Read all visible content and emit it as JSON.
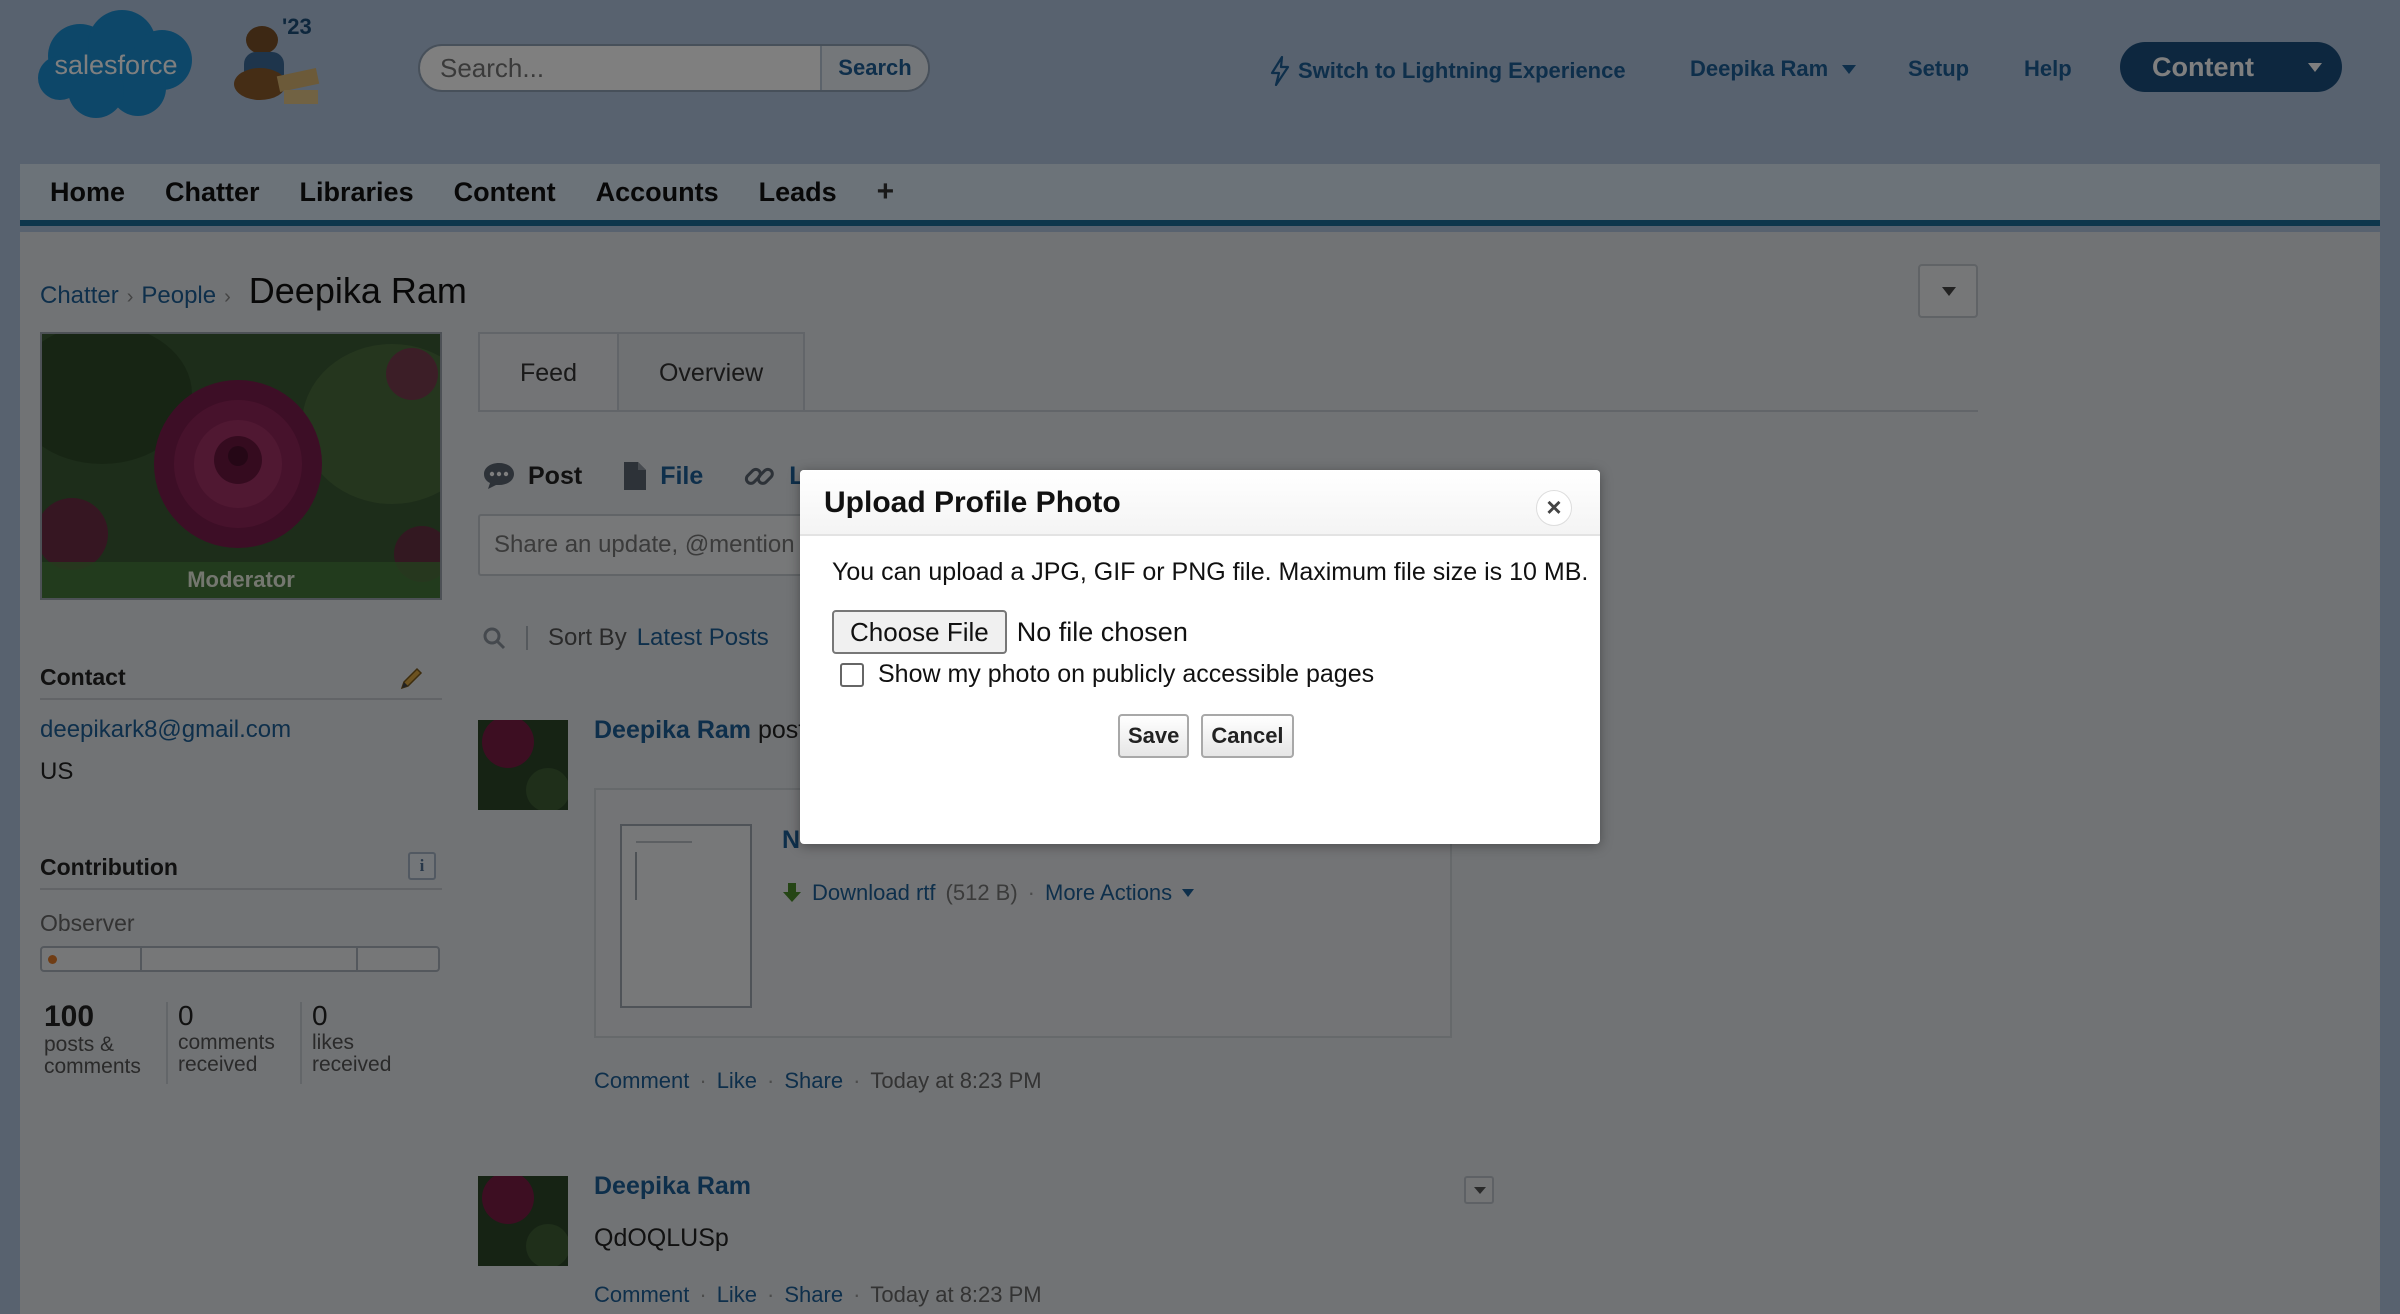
{
  "header": {
    "logo_text": "salesforce",
    "release_badge": "'23",
    "search": {
      "placeholder": "Search...",
      "button_label": "Search"
    },
    "lightning_link": "Switch to Lightning Experience",
    "user_menu": "Deepika Ram",
    "setup_link": "Setup",
    "help_link": "Help",
    "app_switcher": "Content"
  },
  "nav": {
    "tabs": [
      "Home",
      "Chatter",
      "Libraries",
      "Content",
      "Accounts",
      "Leads"
    ],
    "plus": "+"
  },
  "breadcrumb": {
    "items": [
      "Chatter",
      "People"
    ],
    "current": "Deepika Ram"
  },
  "profile": {
    "role_badge": "Moderator",
    "contact_title": "Contact",
    "email": "deepikark8@gmail.com",
    "location": "US",
    "contribution_title": "Contribution",
    "info_glyph": "i",
    "contribution_level": "Observer",
    "stats": [
      {
        "value": "100",
        "label": "posts & comments"
      },
      {
        "value": "0",
        "label": "comments received"
      },
      {
        "value": "0",
        "label": "likes received"
      }
    ]
  },
  "tabs": [
    "Feed",
    "Overview"
  ],
  "publisher": {
    "actions": [
      "Post",
      "File",
      "L"
    ],
    "placeholder": "Share an update, @mention"
  },
  "sort": {
    "label": "Sort By",
    "value": "Latest Posts"
  },
  "feed": [
    {
      "author": "Deepika Ram",
      "action_text": "post",
      "attachment": {
        "title_fragment": "N",
        "download_label": "Download rtf",
        "size": "(512 B)",
        "more_actions": "More Actions"
      },
      "footer": {
        "comment": "Comment",
        "like": "Like",
        "share": "Share",
        "timestamp": "Today at 8:23 PM"
      }
    },
    {
      "author": "Deepika Ram",
      "body": "QdOQLUSp",
      "footer": {
        "comment": "Comment",
        "like": "Like",
        "share": "Share",
        "timestamp": "Today at 8:23 PM"
      }
    }
  ],
  "modal": {
    "title": "Upload Profile Photo",
    "close": "×",
    "instructions": "You can upload a JPG, GIF or PNG file. Maximum file size is 10 MB.",
    "choose_file": "Choose File",
    "file_status": "No file chosen",
    "public_checkbox_label": "Show my photo on publicly accessible pages",
    "public_checkbox_checked": false,
    "save": "Save",
    "cancel": "Cancel"
  },
  "colors": {
    "link": "#1d5f97",
    "header_bg": "#b0c4df",
    "nav_accent": "#1d6c99",
    "app_switcher": "#1b4f7e"
  },
  "icons": [
    "search-icon",
    "lightning-icon",
    "chat-bubble-icon",
    "file-icon",
    "link-icon",
    "pencil-icon",
    "info-icon",
    "download-icon",
    "close-icon"
  ]
}
